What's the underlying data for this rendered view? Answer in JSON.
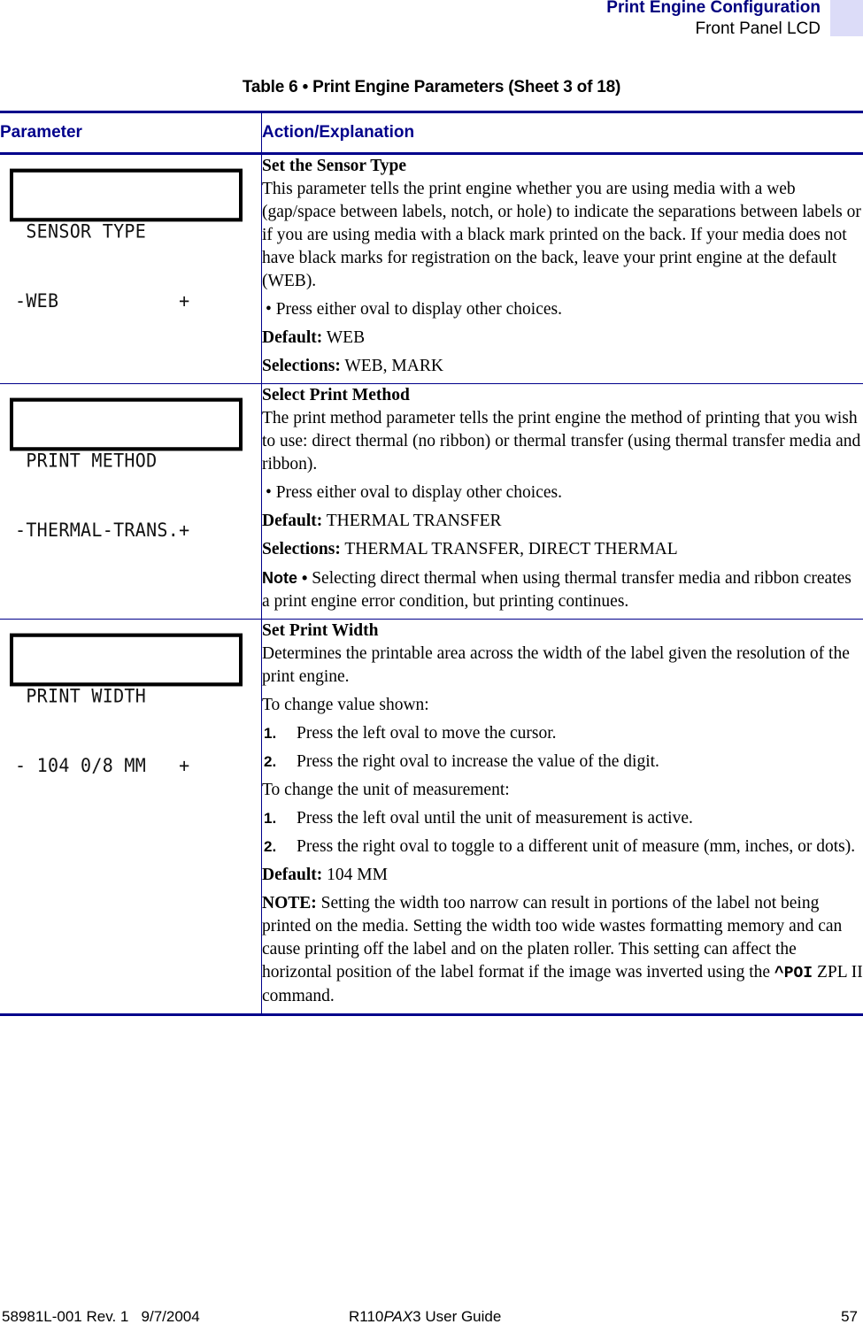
{
  "header": {
    "chapter_title": "Print Engine Configuration",
    "section_title": "Front Panel LCD",
    "tab_color": "#dcdcf8",
    "accent_color": "#00008b"
  },
  "table": {
    "caption": "Table 6 • Print Engine Parameters (Sheet 3 of 18)",
    "columns": [
      "Parameter",
      "Action/Explanation"
    ],
    "rows": [
      {
        "lcd": {
          "line1": " SENSOR TYPE",
          "line2": "-WEB           +"
        },
        "title": "Set the Sensor Type",
        "description": "This parameter tells the print engine whether you are using media with a web (gap/space between labels, notch, or hole) to indicate the separations between labels or if you are using media with a black mark printed on the back. If your media does not have black marks for registration on the back, leave your print engine at the default (WEB).",
        "bullet": "Press either oval to display other choices.",
        "default_label": "Default:",
        "default_value": "WEB",
        "selections_label": "Selections:",
        "selections_value": "WEB, MARK"
      },
      {
        "lcd": {
          "line1": " PRINT METHOD",
          "line2": "-THERMAL-TRANS.+"
        },
        "title": "Select Print Method",
        "description": "The print method parameter tells the print engine the method of printing that you wish to use: direct thermal (no ribbon) or thermal transfer (using thermal transfer media and ribbon).",
        "bullet": "Press either oval to display other choices.",
        "default_label": "Default:",
        "default_value": "THERMAL TRANSFER",
        "selections_label": "Selections:",
        "selections_value": "THERMAL TRANSFER, DIRECT THERMAL",
        "note_label": "Note •",
        "note_text": "Selecting direct thermal when using thermal transfer media and ribbon creates a print engine error condition, but printing continues."
      },
      {
        "lcd": {
          "line1": " PRINT WIDTH",
          "line2": "- 104 0/8 MM   +"
        },
        "title": "Set Print Width",
        "description": "Determines the printable area across the width of the label given the resolution of the print engine.",
        "intro1": "To change value shown:",
        "steps1": [
          {
            "num": "1.",
            "text": "Press the left oval to move the cursor."
          },
          {
            "num": "2.",
            "text": "Press the right oval to increase the value of the digit."
          }
        ],
        "intro2": "To change the unit of measurement:",
        "steps2": [
          {
            "num": "1.",
            "text": "Press the left oval until the unit of measurement is active."
          },
          {
            "num": "2.",
            "text": "Press the right oval to toggle to a different unit of measure (mm, inches, or dots)."
          }
        ],
        "default_label": "Default:",
        "default_value": "104 MM",
        "note_label": "NOTE:",
        "note_text_before": "Setting the width too narrow can result in portions of the label not being printed on the media. Setting the width too wide wastes formatting memory and can cause printing off the label and on the platen roller. This setting can affect the horizontal position of the label format if the image was inverted using the",
        "note_command": "^POI",
        "note_text_after": "ZPL II command."
      }
    ]
  },
  "footer": {
    "doc_number": "58981L-001 Rev. 1",
    "date": "9/7/2004",
    "guide_prefix": "R110",
    "guide_italic": "PAX",
    "guide_suffix": "3 User Guide",
    "page_number": "57"
  }
}
